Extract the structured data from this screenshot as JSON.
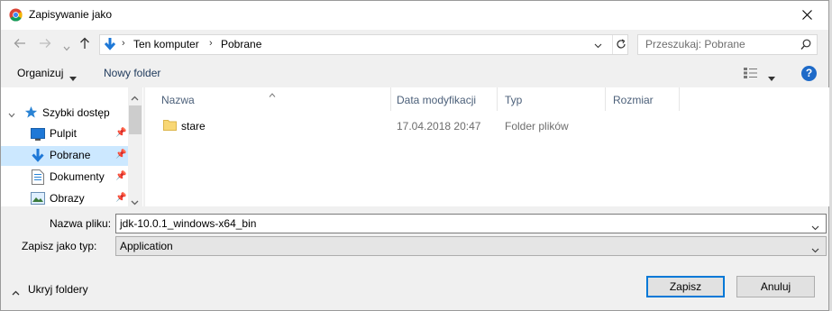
{
  "window": {
    "title": "Zapisywanie jako",
    "icon": "chrome-icon",
    "close_icon": "close-icon"
  },
  "navigation": {
    "back_icon": "arrow-left-icon",
    "forward_icon": "arrow-right-icon",
    "recent_icon": "chevron-down-icon",
    "up_icon": "arrow-up-icon"
  },
  "address": {
    "location_icon": "download-folder-icon",
    "crumbs": [
      "Ten komputer",
      "Pobrane"
    ]
  },
  "search": {
    "placeholder": "Przeszukaj: Pobrane"
  },
  "toolbar": {
    "organize_label": "Organizuj",
    "new_folder_label": "Nowy folder",
    "help_label": "?"
  },
  "nav_pane": {
    "items": [
      {
        "label": "Szybki dostęp",
        "icon": "star-icon"
      },
      {
        "label": "Pulpit",
        "icon": "desktop-icon",
        "pinned": true
      },
      {
        "label": "Pobrane",
        "icon": "download-icon",
        "pinned": true,
        "selected": true
      },
      {
        "label": "Dokumenty",
        "icon": "documents-icon",
        "pinned": true
      },
      {
        "label": "Obrazy",
        "icon": "pictures-icon",
        "pinned": true
      }
    ]
  },
  "file_list": {
    "columns": [
      "Nazwa",
      "Data modyfikacji",
      "Typ",
      "Rozmiar"
    ],
    "rows": [
      {
        "name": "stare",
        "date": "17.04.2018 20:47",
        "type": "Folder plików",
        "size": ""
      }
    ]
  },
  "form": {
    "filename_label": "Nazwa pliku:",
    "filename_value": "jdk-10.0.1_windows-x64_bin",
    "filetype_label": "Zapisz jako typ:",
    "filetype_value": "Application"
  },
  "footer": {
    "hide_folders_label": "Ukryj foldery",
    "save_label": "Zapisz",
    "cancel_label": "Anuluj"
  },
  "colors": {
    "accent": "#0078d7",
    "selection": "#cce8ff",
    "link": "#1e395b",
    "help": "#1e6ac8"
  }
}
